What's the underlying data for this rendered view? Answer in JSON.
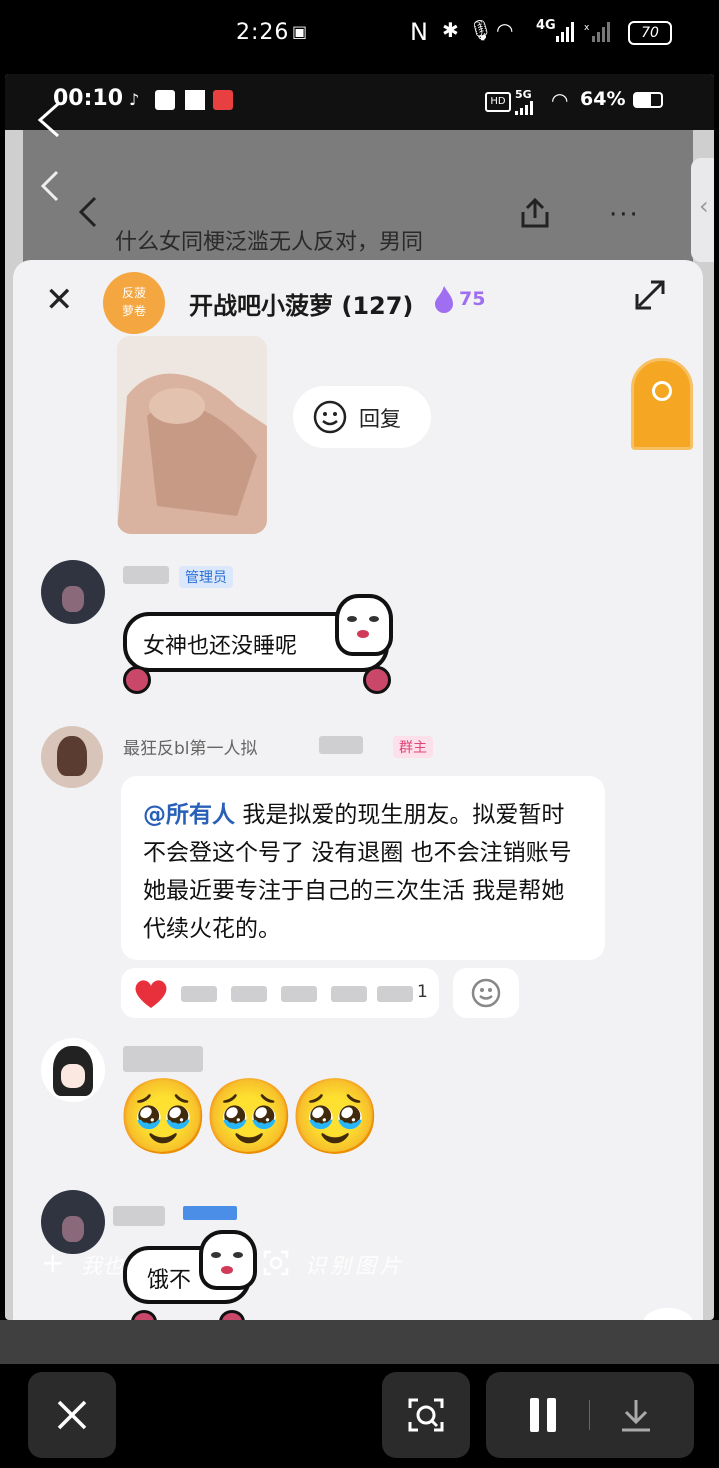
{
  "outer_status": {
    "time": "2:26",
    "network": "4G",
    "battery": "70"
  },
  "inner_status": {
    "time": "00:10",
    "network": "5G",
    "battery": "64%"
  },
  "dim_header": {
    "title_fragment": "什么女同梗泛滥无人反对，男同"
  },
  "group": {
    "avatar_text_1": "反菠",
    "avatar_text_2": "萝卷",
    "title": "开战吧小菠萝 (127)",
    "flame_count": "75"
  },
  "messages": {
    "reply_label": "回复",
    "admin_badge": "管理员",
    "sticker_text_1": "女神也还没睡呢",
    "owner_name": "最狂反bl第一人拟",
    "owner_badge": "群主",
    "mention": "@所有人",
    "owner_message": "我是拟爱的现生朋友。拟爱暂时不会登这个号了 没有退圈 也不会注销账号 她最近要专注于自己的三次生活 我是帮她代续火花的。",
    "reaction_count": "1",
    "emojis": [
      "🥹",
      "🥹",
      "🥹"
    ],
    "sticker_text_2": "饿不"
  },
  "overlay": {
    "add_label": "我也",
    "recognize_label": "识别图片"
  },
  "icons": {
    "back": "chevron-left-icon",
    "share": "share-icon",
    "more": "more-icon",
    "close": "close-icon",
    "expand": "expand-icon",
    "smile": "smile-icon",
    "heart": "heart-icon",
    "scan": "scan-icon",
    "pause": "pause-icon",
    "download": "download-icon"
  },
  "colors": {
    "accent_blue": "#2a6fd6",
    "owner_badge": "#e0457a",
    "flame": "#a06ef0",
    "group_avatar": "#f4a640"
  }
}
